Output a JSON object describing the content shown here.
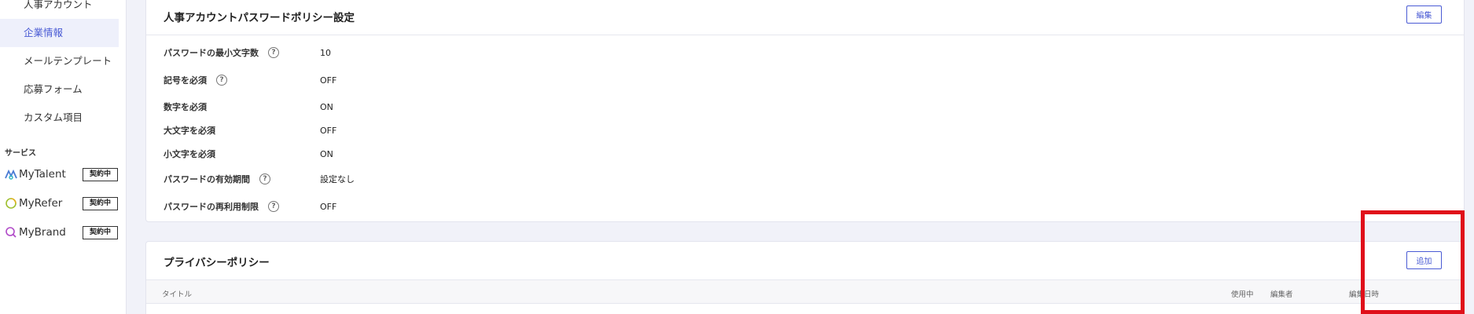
{
  "sidebar": {
    "items": [
      {
        "label": "人事アカウント",
        "active": false
      },
      {
        "label": "企業情報",
        "active": true
      },
      {
        "label": "メールテンプレート",
        "active": false
      },
      {
        "label": "応募フォーム",
        "active": false
      },
      {
        "label": "カスタム項目",
        "active": false
      }
    ],
    "section_label": "サービス",
    "services": [
      {
        "name": "MyTalent",
        "badge": "契約中",
        "icon": "mytalent-logo-icon",
        "color": "#4a7bd4"
      },
      {
        "name": "MyRefer",
        "badge": "契約中",
        "icon": "myrefer-logo-icon",
        "color": "#9fbf2f"
      },
      {
        "name": "MyBrand",
        "badge": "契約中",
        "icon": "mybrand-logo-icon",
        "color": "#b04ac8"
      }
    ]
  },
  "password_policy": {
    "title": "人事アカウントパスワードポリシー設定",
    "edit_label": "編集",
    "rows": [
      {
        "label": "パスワードの最小文字数",
        "help": true,
        "value": "10"
      },
      {
        "label": "記号を必須",
        "help": true,
        "value": "OFF"
      },
      {
        "label": "数字を必須",
        "help": false,
        "value": "ON"
      },
      {
        "label": "大文字を必須",
        "help": false,
        "value": "OFF"
      },
      {
        "label": "小文字を必須",
        "help": false,
        "value": "ON"
      },
      {
        "label": "パスワードの有効期間",
        "help": true,
        "value": "設定なし"
      },
      {
        "label": "パスワードの再利用制限",
        "help": true,
        "value": "OFF"
      }
    ]
  },
  "privacy_policy": {
    "title": "プライバシーポリシー",
    "add_label": "追加",
    "columns": [
      "タイトル",
      "使用中",
      "編集者",
      "編集日時"
    ]
  },
  "colors": {
    "accent": "#4a5bd4",
    "highlight": "#e0101a"
  }
}
